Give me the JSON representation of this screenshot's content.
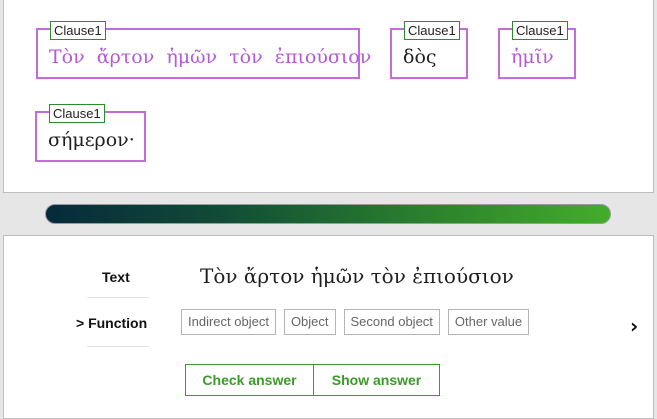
{
  "clauses": [
    {
      "tag": "Clause1",
      "text": "Τὸν  ἄρτον  ἡμῶν  τὸν  ἐπιούσιον",
      "color": "#b45ad6"
    },
    {
      "tag": "Clause1",
      "text": "δὸς",
      "color": "#1f1f1f"
    },
    {
      "tag": "Clause1",
      "text": "ἡμῖν",
      "color": "#b45ad6"
    },
    {
      "tag": "Clause1",
      "text": "σήμερον·",
      "color": "#1f1f1f"
    }
  ],
  "progress": {
    "percent": 100
  },
  "question": {
    "text_label": "Text",
    "greek_text": "Τὸν ἄρτον ἡμῶν τὸν ἐπιούσιον",
    "function_label": "> Function",
    "options": [
      "Indirect object",
      "Object",
      "Second object",
      "Other value"
    ],
    "next_icon": "›"
  },
  "buttons": {
    "check": "Check answer",
    "show": "Show answer"
  },
  "colors": {
    "clause_border": "#c46be0",
    "accent_green": "#3a9a2a"
  }
}
